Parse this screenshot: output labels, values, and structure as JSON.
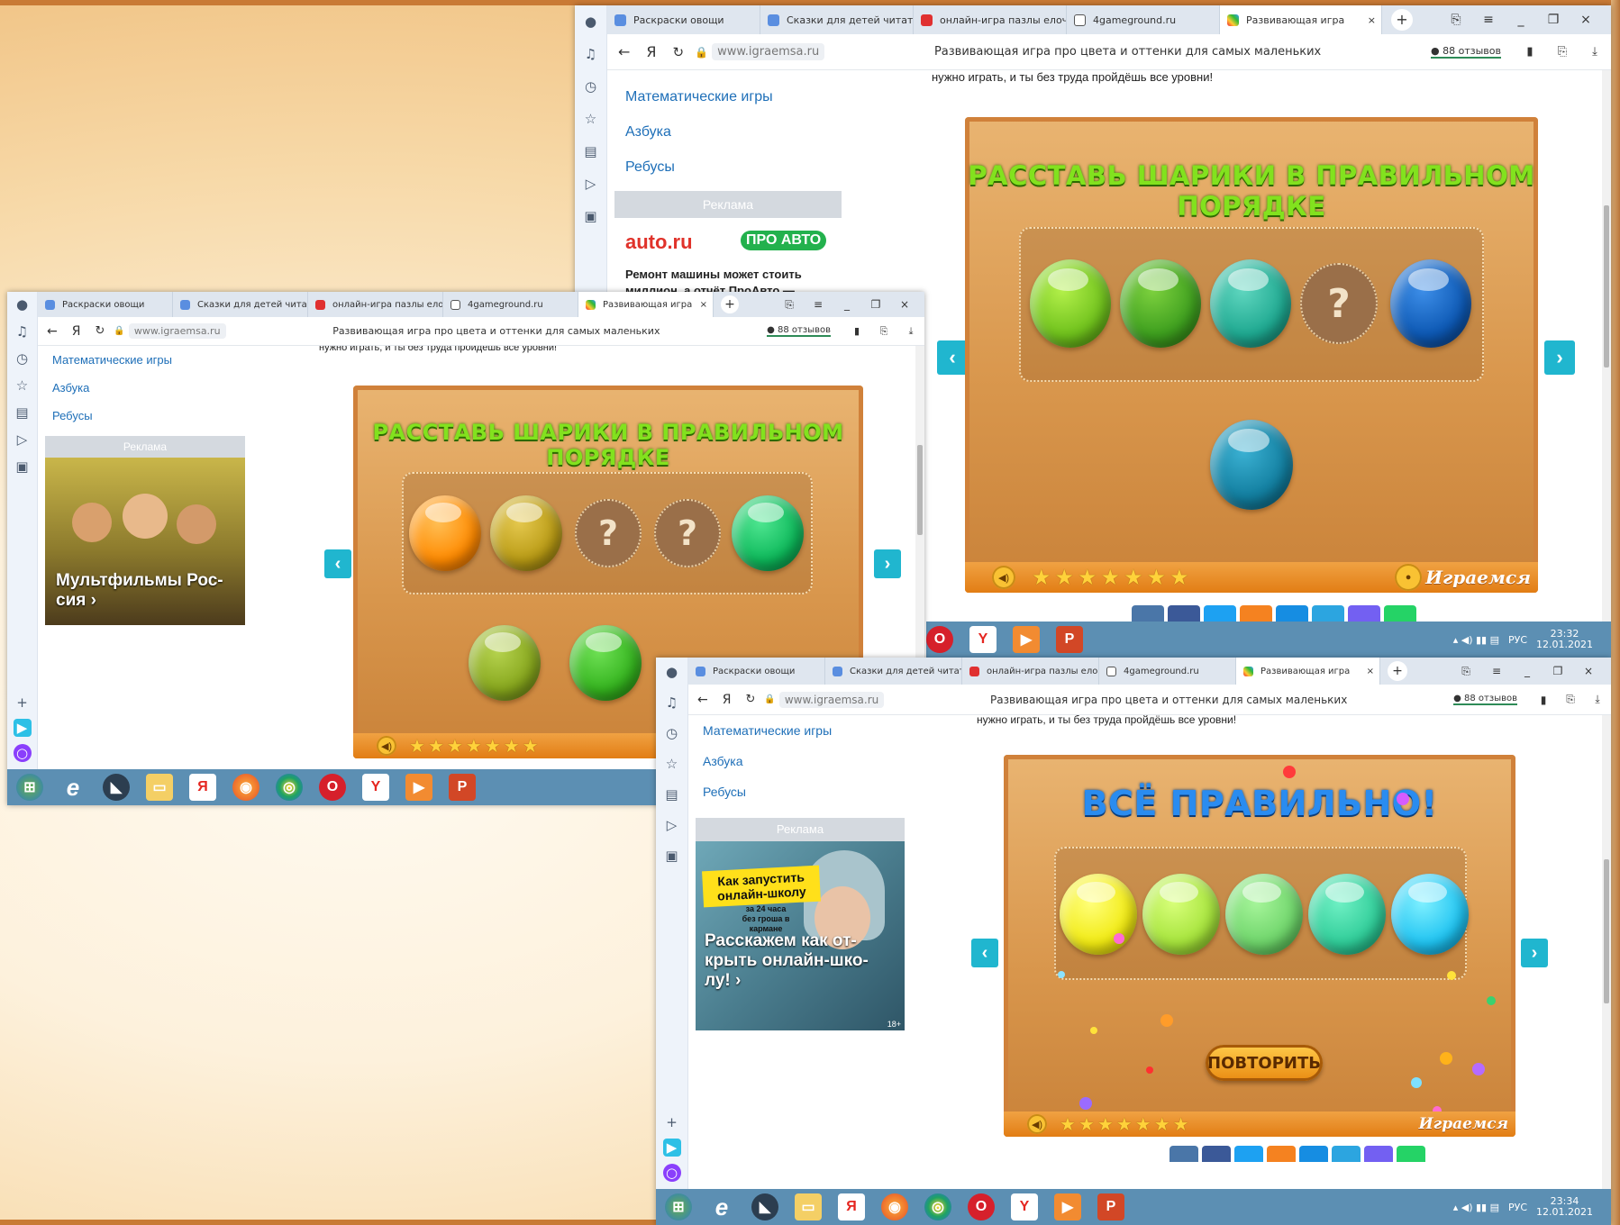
{
  "browser": {
    "tabs": [
      "Раскраски овощи",
      "Сказки для детей читать с",
      "онлайн-игра пазлы елочк",
      "4gameground.ru",
      "Развивающая игра"
    ],
    "url": "www.igraemsa.ru",
    "page_title": "Развивающая игра про цвета и оттенки для самых маленьких",
    "reviews": "88 отзывов"
  },
  "sidebar_menu": [
    "Математические игры",
    "Азбука",
    "Ребусы"
  ],
  "intro_text": "нужно играть, и ты без труда пройдёшь все уровни!",
  "ad_label": "Реклама",
  "ads": {
    "auto": {
      "logo": "auto.ru",
      "badge": "ПРО АВТО",
      "text": "Ремонт машины может стоить миллион, а отчёт ПроАвто —"
    },
    "cartoons": {
      "text": "Мультфильмы Рос-сия ›"
    },
    "school": {
      "headline": "Как запустить онлайн-школу",
      "sub1": "за 24 часа",
      "sub2": "без гроша в кармане",
      "text": "Расскажем как от-крыть онлайн-шко-лу! ›",
      "age": "18+"
    }
  },
  "game": {
    "title": "РАССТАВЬ ШАРИКИ В ПРАВИЛЬНОМ ПОРЯДКЕ",
    "done_title": "ВСЁ ПРАВИЛЬНО!",
    "repeat": "ПОВТОРИТЬ",
    "brand": "Играемся",
    "q": "?",
    "prev": "‹",
    "next": "›"
  },
  "taskbar": {
    "lang": "РУС",
    "time1": "23:32",
    "date1": "12.01.2021",
    "time2": "23:34",
    "date2": "12.01.2021"
  },
  "colors": {
    "accent": "#20b6cf",
    "link": "#1e6fb8",
    "title_green": "#7de020",
    "title_blue": "#2a8cf0"
  }
}
